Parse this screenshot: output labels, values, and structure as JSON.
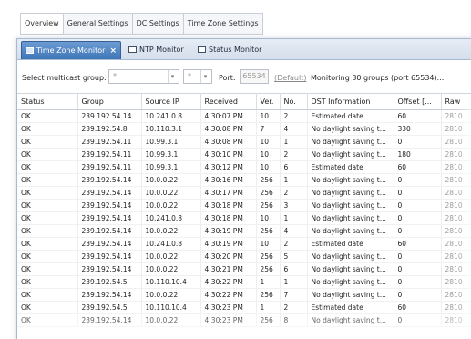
{
  "settings_tabs": [
    "Overview",
    "General Settings",
    "DC Settings",
    "Time Zone Settings"
  ],
  "doc_tabs": [
    {
      "label": "Time Zone Monitor",
      "icon": "monitor-icon",
      "active": true,
      "closable": true
    },
    {
      "label": "NTP Monitor",
      "icon": "monitor-icon",
      "active": false,
      "closable": false
    },
    {
      "label": "Status Monitor",
      "icon": "monitor-icon",
      "active": false,
      "closable": false
    }
  ],
  "filter": {
    "group_label": "Select multicast group:",
    "group_value": "*",
    "sub_value": "*",
    "port_label": "Port:",
    "port_value": "65534",
    "default_link": "(Default)",
    "status_text": "Monitoring 30 groups (port 65534)..."
  },
  "table": {
    "columns": [
      "Status",
      "Group",
      "Source IP",
      "Received",
      "Ver.",
      "No.",
      "DST Information",
      "Offset [...",
      "Raw"
    ],
    "rows": [
      [
        "OK",
        "239.192.54.14",
        "10.241.0.8",
        "4:30:07 PM",
        "10",
        "2",
        "Estimated date",
        "60",
        "2810"
      ],
      [
        "OK",
        "239.192.54.8",
        "10.110.3.1",
        "4:30:08 PM",
        "7",
        "4",
        "No daylight saving t...",
        "330",
        "2810"
      ],
      [
        "OK",
        "239.192.54.11",
        "10.99.3.1",
        "4:30:08 PM",
        "10",
        "1",
        "No daylight saving t...",
        "0",
        "2810"
      ],
      [
        "OK",
        "239.192.54.11",
        "10.99.3.1",
        "4:30:10 PM",
        "10",
        "2",
        "No daylight saving t...",
        "180",
        "2810"
      ],
      [
        "OK",
        "239.192.54.11",
        "10.99.3.1",
        "4:30:12 PM",
        "10",
        "6",
        "Estimated date",
        "60",
        "2810"
      ],
      [
        "OK",
        "239.192.54.14",
        "10.0.0.22",
        "4:30:16 PM",
        "256",
        "1",
        "No daylight saving t...",
        "0",
        "2810"
      ],
      [
        "OK",
        "239.192.54.14",
        "10.0.0.22",
        "4:30:17 PM",
        "256",
        "2",
        "No daylight saving t...",
        "0",
        "2810"
      ],
      [
        "OK",
        "239.192.54.14",
        "10.0.0.22",
        "4:30:18 PM",
        "256",
        "3",
        "No daylight saving t...",
        "0",
        "2810"
      ],
      [
        "OK",
        "239.192.54.14",
        "10.241.0.8",
        "4:30:18 PM",
        "10",
        "1",
        "No daylight saving t...",
        "0",
        "2810"
      ],
      [
        "OK",
        "239.192.54.14",
        "10.0.0.22",
        "4:30:19 PM",
        "256",
        "4",
        "No daylight saving t...",
        "0",
        "2810"
      ],
      [
        "OK",
        "239.192.54.14",
        "10.241.0.8",
        "4:30:19 PM",
        "10",
        "2",
        "Estimated date",
        "60",
        "2810"
      ],
      [
        "OK",
        "239.192.54.14",
        "10.0.0.22",
        "4:30:20 PM",
        "256",
        "5",
        "No daylight saving t...",
        "0",
        "2810"
      ],
      [
        "OK",
        "239.192.54.14",
        "10.0.0.22",
        "4:30:21 PM",
        "256",
        "6",
        "No daylight saving t...",
        "0",
        "2810"
      ],
      [
        "OK",
        "239.192.54.5",
        "10.110.10.4",
        "4:30:22 PM",
        "1",
        "1",
        "No daylight saving t...",
        "0",
        "2810"
      ],
      [
        "OK",
        "239.192.54.14",
        "10.0.0.22",
        "4:30:22 PM",
        "256",
        "7",
        "No daylight saving t...",
        "0",
        "2810"
      ],
      [
        "OK",
        "239.192.54.5",
        "10.110.10.4",
        "4:30:23 PM",
        "1",
        "2",
        "Estimated date",
        "60",
        "2810"
      ],
      [
        "OK",
        "239.192.54.14",
        "10.0.0.22",
        "4:30:23 PM",
        "256",
        "8",
        "No daylight saving t...",
        "0",
        "2810"
      ]
    ]
  }
}
